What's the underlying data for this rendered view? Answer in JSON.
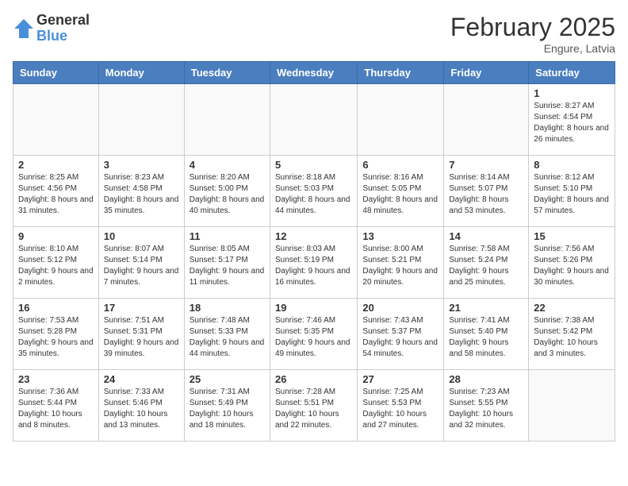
{
  "logo": {
    "general": "General",
    "blue": "Blue"
  },
  "title": "February 2025",
  "location": "Engure, Latvia",
  "days_of_week": [
    "Sunday",
    "Monday",
    "Tuesday",
    "Wednesday",
    "Thursday",
    "Friday",
    "Saturday"
  ],
  "weeks": [
    [
      {
        "day": "",
        "info": ""
      },
      {
        "day": "",
        "info": ""
      },
      {
        "day": "",
        "info": ""
      },
      {
        "day": "",
        "info": ""
      },
      {
        "day": "",
        "info": ""
      },
      {
        "day": "",
        "info": ""
      },
      {
        "day": "1",
        "info": "Sunrise: 8:27 AM\nSunset: 4:54 PM\nDaylight: 8 hours and 26 minutes."
      }
    ],
    [
      {
        "day": "2",
        "info": "Sunrise: 8:25 AM\nSunset: 4:56 PM\nDaylight: 8 hours and 31 minutes."
      },
      {
        "day": "3",
        "info": "Sunrise: 8:23 AM\nSunset: 4:58 PM\nDaylight: 8 hours and 35 minutes."
      },
      {
        "day": "4",
        "info": "Sunrise: 8:20 AM\nSunset: 5:00 PM\nDaylight: 8 hours and 40 minutes."
      },
      {
        "day": "5",
        "info": "Sunrise: 8:18 AM\nSunset: 5:03 PM\nDaylight: 8 hours and 44 minutes."
      },
      {
        "day": "6",
        "info": "Sunrise: 8:16 AM\nSunset: 5:05 PM\nDaylight: 8 hours and 48 minutes."
      },
      {
        "day": "7",
        "info": "Sunrise: 8:14 AM\nSunset: 5:07 PM\nDaylight: 8 hours and 53 minutes."
      },
      {
        "day": "8",
        "info": "Sunrise: 8:12 AM\nSunset: 5:10 PM\nDaylight: 8 hours and 57 minutes."
      }
    ],
    [
      {
        "day": "9",
        "info": "Sunrise: 8:10 AM\nSunset: 5:12 PM\nDaylight: 9 hours and 2 minutes."
      },
      {
        "day": "10",
        "info": "Sunrise: 8:07 AM\nSunset: 5:14 PM\nDaylight: 9 hours and 7 minutes."
      },
      {
        "day": "11",
        "info": "Sunrise: 8:05 AM\nSunset: 5:17 PM\nDaylight: 9 hours and 11 minutes."
      },
      {
        "day": "12",
        "info": "Sunrise: 8:03 AM\nSunset: 5:19 PM\nDaylight: 9 hours and 16 minutes."
      },
      {
        "day": "13",
        "info": "Sunrise: 8:00 AM\nSunset: 5:21 PM\nDaylight: 9 hours and 20 minutes."
      },
      {
        "day": "14",
        "info": "Sunrise: 7:58 AM\nSunset: 5:24 PM\nDaylight: 9 hours and 25 minutes."
      },
      {
        "day": "15",
        "info": "Sunrise: 7:56 AM\nSunset: 5:26 PM\nDaylight: 9 hours and 30 minutes."
      }
    ],
    [
      {
        "day": "16",
        "info": "Sunrise: 7:53 AM\nSunset: 5:28 PM\nDaylight: 9 hours and 35 minutes."
      },
      {
        "day": "17",
        "info": "Sunrise: 7:51 AM\nSunset: 5:31 PM\nDaylight: 9 hours and 39 minutes."
      },
      {
        "day": "18",
        "info": "Sunrise: 7:48 AM\nSunset: 5:33 PM\nDaylight: 9 hours and 44 minutes."
      },
      {
        "day": "19",
        "info": "Sunrise: 7:46 AM\nSunset: 5:35 PM\nDaylight: 9 hours and 49 minutes."
      },
      {
        "day": "20",
        "info": "Sunrise: 7:43 AM\nSunset: 5:37 PM\nDaylight: 9 hours and 54 minutes."
      },
      {
        "day": "21",
        "info": "Sunrise: 7:41 AM\nSunset: 5:40 PM\nDaylight: 9 hours and 58 minutes."
      },
      {
        "day": "22",
        "info": "Sunrise: 7:38 AM\nSunset: 5:42 PM\nDaylight: 10 hours and 3 minutes."
      }
    ],
    [
      {
        "day": "23",
        "info": "Sunrise: 7:36 AM\nSunset: 5:44 PM\nDaylight: 10 hours and 8 minutes."
      },
      {
        "day": "24",
        "info": "Sunrise: 7:33 AM\nSunset: 5:46 PM\nDaylight: 10 hours and 13 minutes."
      },
      {
        "day": "25",
        "info": "Sunrise: 7:31 AM\nSunset: 5:49 PM\nDaylight: 10 hours and 18 minutes."
      },
      {
        "day": "26",
        "info": "Sunrise: 7:28 AM\nSunset: 5:51 PM\nDaylight: 10 hours and 22 minutes."
      },
      {
        "day": "27",
        "info": "Sunrise: 7:25 AM\nSunset: 5:53 PM\nDaylight: 10 hours and 27 minutes."
      },
      {
        "day": "28",
        "info": "Sunrise: 7:23 AM\nSunset: 5:55 PM\nDaylight: 10 hours and 32 minutes."
      },
      {
        "day": "",
        "info": ""
      }
    ]
  ]
}
